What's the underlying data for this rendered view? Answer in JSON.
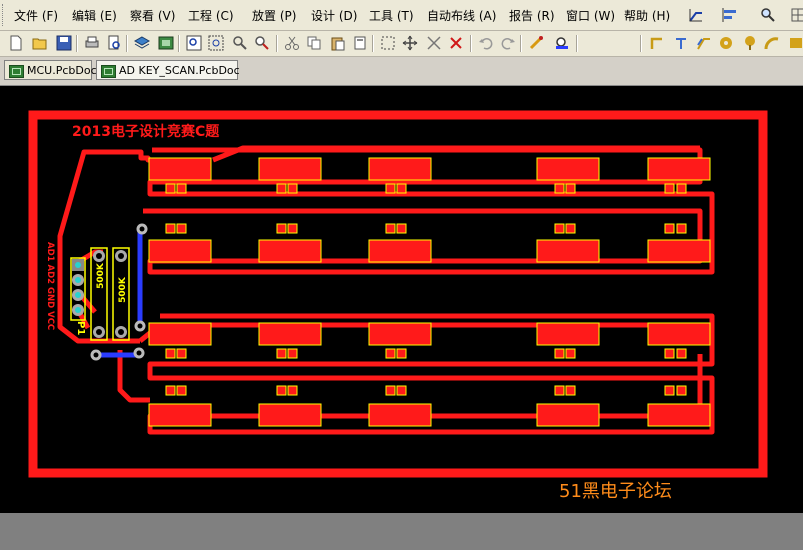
{
  "menu": {
    "items": [
      "文件 (F)",
      "编辑 (E)",
      "察看 (V)",
      "工程 (C)",
      "放置 (P)",
      "设计 (D)",
      "工具 (T)",
      "自动布线 (A)",
      "报告 (R)",
      "窗口 (W)",
      "帮助 (H)"
    ]
  },
  "tabs": [
    "MCU.PcbDoc",
    "AD KEY_SCAN.PcbDoc"
  ],
  "pcb": {
    "title": "2013电子设计竞赛C题",
    "watermark": "51黑电子论坛",
    "connector_labels": "AD1 AD2 GND VCC",
    "connector_ref": "P1",
    "resistor_labels": [
      "500K",
      "500K"
    ]
  },
  "colors": {
    "top_layer": "#ff1a1a",
    "bottom_layer": "#2a3cff",
    "silkscreen": "#ffff00",
    "watermark": "#ff8c1a",
    "canvas": "#000000"
  }
}
